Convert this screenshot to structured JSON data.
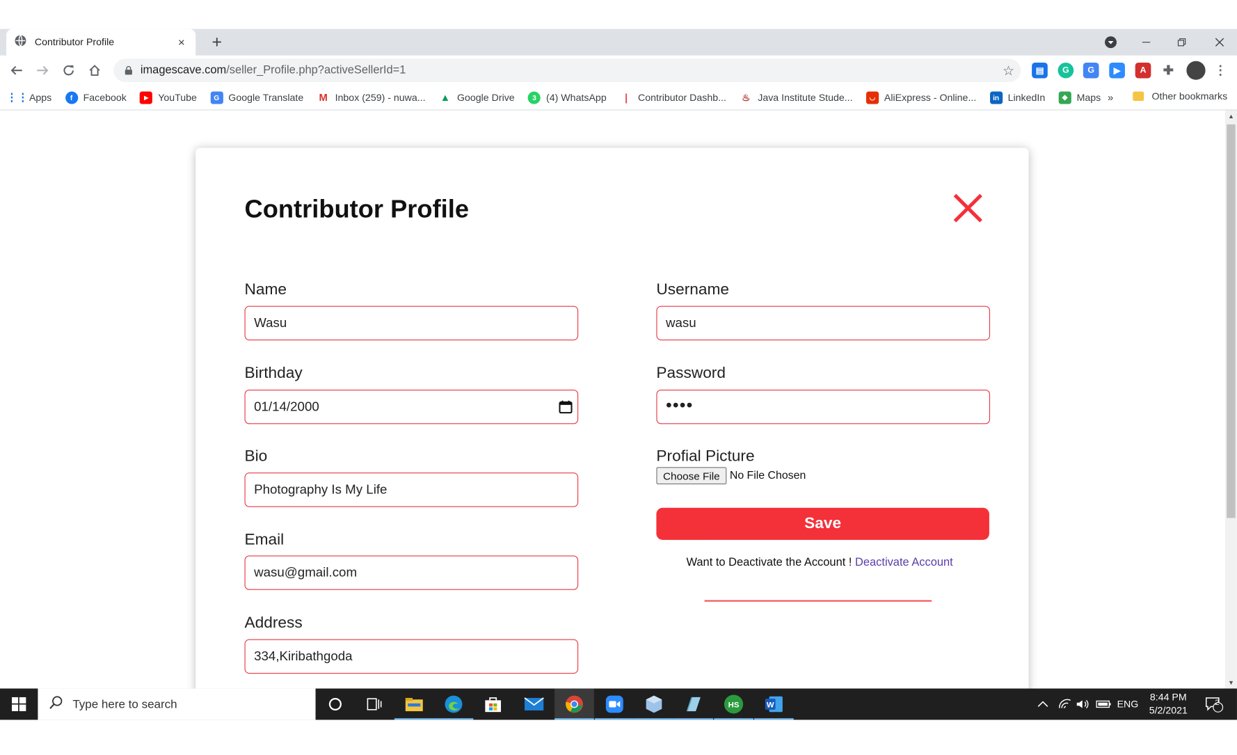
{
  "browser": {
    "tab_title": "Contributor Profile",
    "tab_close": "×",
    "new_tab": "+",
    "url_domain": "imagescave.com",
    "url_path": "/seller_Profile.php?activeSellerId=1",
    "bookmarks": [
      {
        "label": "Apps",
        "icon": "apps-grid-icon",
        "color": "#1a73e8"
      },
      {
        "label": "Facebook",
        "icon": "facebook-icon",
        "color": "#1877f2"
      },
      {
        "label": "YouTube",
        "icon": "youtube-icon",
        "color": "#ff0000"
      },
      {
        "label": "Google Translate",
        "icon": "google-translate-icon",
        "color": "#4285f4"
      },
      {
        "label": "Inbox (259) - nuwa...",
        "icon": "gmail-icon",
        "color": "#d93025"
      },
      {
        "label": "Google Drive",
        "icon": "google-drive-icon",
        "color": "#0f9d58"
      },
      {
        "label": "(4) WhatsApp",
        "icon": "whatsapp-icon",
        "color": "#25d366"
      },
      {
        "label": "Contributor Dashb...",
        "icon": "contributor-dashboard-icon",
        "color": "#e53945"
      },
      {
        "label": "Java Institute Stude...",
        "icon": "java-institute-icon",
        "color": "#b23a2a"
      },
      {
        "label": "AliExpress - Online...",
        "icon": "aliexpress-icon",
        "color": "#e62e04"
      },
      {
        "label": "LinkedIn",
        "icon": "linkedin-icon",
        "color": "#0a66c2"
      },
      {
        "label": "Maps",
        "icon": "google-maps-icon",
        "color": "#34a853"
      }
    ],
    "bookmarks_more": "»",
    "other_bookmarks": "Other bookmarks"
  },
  "page": {
    "title": "Contributor Profile",
    "fields": {
      "name": {
        "label": "Name",
        "value": "Wasu"
      },
      "birthday": {
        "label": "Birthday",
        "value": "01/14/2000"
      },
      "bio": {
        "label": "Bio",
        "value": "Photography Is My Life"
      },
      "email": {
        "label": "Email",
        "value": "wasu@gmail.com"
      },
      "address": {
        "label": "Address",
        "value": "334,Kiribathgoda"
      },
      "username": {
        "label": "Username",
        "value": "wasu"
      },
      "password": {
        "label": "Password",
        "value": "••••"
      },
      "picture": {
        "label": "Profial Picture",
        "button": "Choose File",
        "status": "No File Chosen"
      }
    },
    "save_label": "Save",
    "deactivate_prompt": "Want to Deactivate the Account !",
    "deactivate_link": "Deactivate Account",
    "accent_color": "#f43039"
  },
  "taskbar": {
    "search_placeholder": "Type here to search",
    "apps": [
      "cortana-icon",
      "task-view-icon",
      "file-explorer-icon",
      "edge-icon",
      "microsoft-store-icon",
      "mail-icon",
      "chrome-icon",
      "zoom-icon",
      "virtualbox-icon",
      "notepad-icon",
      "hs-app-icon",
      "word-icon"
    ],
    "language": "ENG",
    "time": "8:44 PM",
    "date": "5/2/2021",
    "notification_count": "2"
  }
}
